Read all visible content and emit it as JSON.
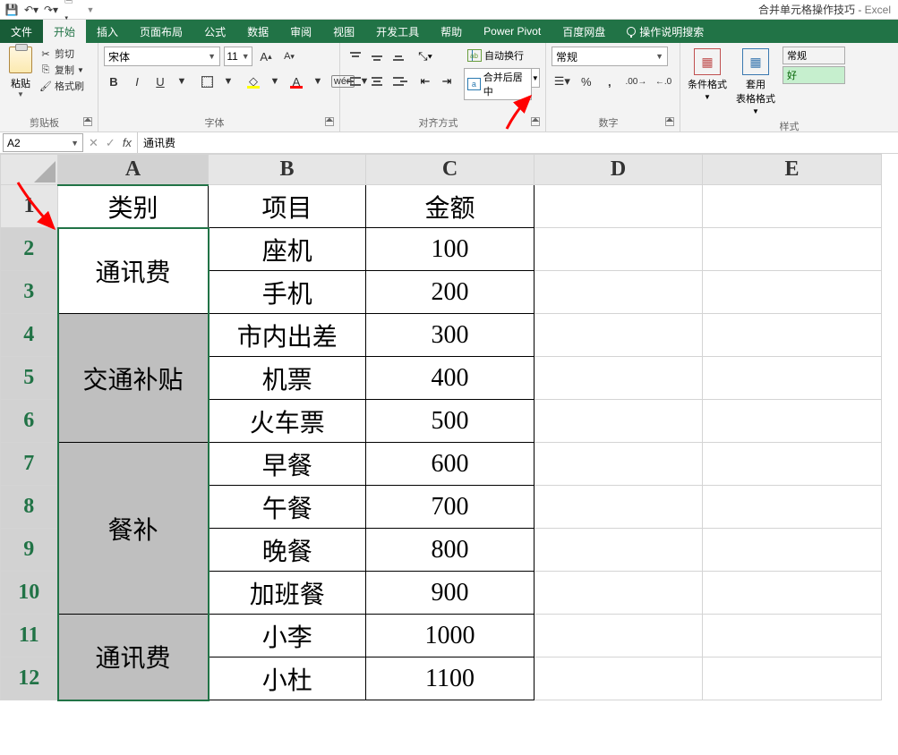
{
  "qat": {
    "title_doc": "合并单元格操作技巧",
    "title_sep": " - ",
    "title_app": "Excel"
  },
  "tabs": {
    "file": "文件",
    "home": "开始",
    "insert": "插入",
    "layout": "页面布局",
    "formulas": "公式",
    "data": "数据",
    "review": "审阅",
    "view": "视图",
    "dev": "开发工具",
    "help": "帮助",
    "powerpivot": "Power Pivot",
    "baidu": "百度网盘",
    "tell_me": "操作说明搜索"
  },
  "ribbon": {
    "clipboard": {
      "paste": "粘贴",
      "cut": "剪切",
      "copy": "复制",
      "format_painter": "格式刷",
      "label": "剪贴板"
    },
    "font": {
      "name": "宋体",
      "size": "11",
      "label": "字体"
    },
    "alignment": {
      "wrap_text": "自动换行",
      "merge_center": "合并后居中",
      "label": "对齐方式"
    },
    "number": {
      "format": "常规",
      "label": "数字"
    },
    "styles": {
      "cond_format": "条件格式",
      "table_format": "套用\n表格格式",
      "normal": "常规",
      "good": "好",
      "label": "样式"
    }
  },
  "formula": {
    "name_box": "A2",
    "value": "通讯费"
  },
  "columns": [
    "A",
    "B",
    "C",
    "D",
    "E"
  ],
  "rows": [
    "1",
    "2",
    "3",
    "4",
    "5",
    "6",
    "7",
    "8",
    "9",
    "10",
    "11",
    "12"
  ],
  "chart_data": {
    "type": "table",
    "title": "",
    "headers": {
      "A": "类别",
      "B": "项目",
      "C": "金额"
    },
    "data": [
      {
        "A": "通讯费",
        "B": "座机",
        "C": 100
      },
      {
        "A": "通讯费",
        "B": "手机",
        "C": 200
      },
      {
        "A": "交通补贴",
        "B": "市内出差",
        "C": 300
      },
      {
        "A": "交通补贴",
        "B": "机票",
        "C": 400
      },
      {
        "A": "交通补贴",
        "B": "火车票",
        "C": 500
      },
      {
        "A": "餐补",
        "B": "早餐",
        "C": 600
      },
      {
        "A": "餐补",
        "B": "午餐",
        "C": 700
      },
      {
        "A": "餐补",
        "B": "晚餐",
        "C": 800
      },
      {
        "A": "餐补",
        "B": "加班餐",
        "C": 900
      },
      {
        "A": "通讯费",
        "B": "小李",
        "C": 1000
      },
      {
        "A": "通讯费",
        "B": "小杜",
        "C": 1100
      }
    ],
    "merged_A_display": {
      "通讯费_1": {
        "rows": [
          2,
          3
        ],
        "label": "通讯费"
      },
      "交通补贴": {
        "rows": [
          4,
          5,
          6
        ],
        "label": "交通补贴"
      },
      "餐补": {
        "rows": [
          7,
          8,
          9,
          10
        ],
        "label": "餐补"
      },
      "通讯费_2": {
        "rows": [
          11,
          12
        ],
        "label": "通讯费"
      }
    },
    "selection": "A2:A12",
    "active_cell": "A2"
  }
}
